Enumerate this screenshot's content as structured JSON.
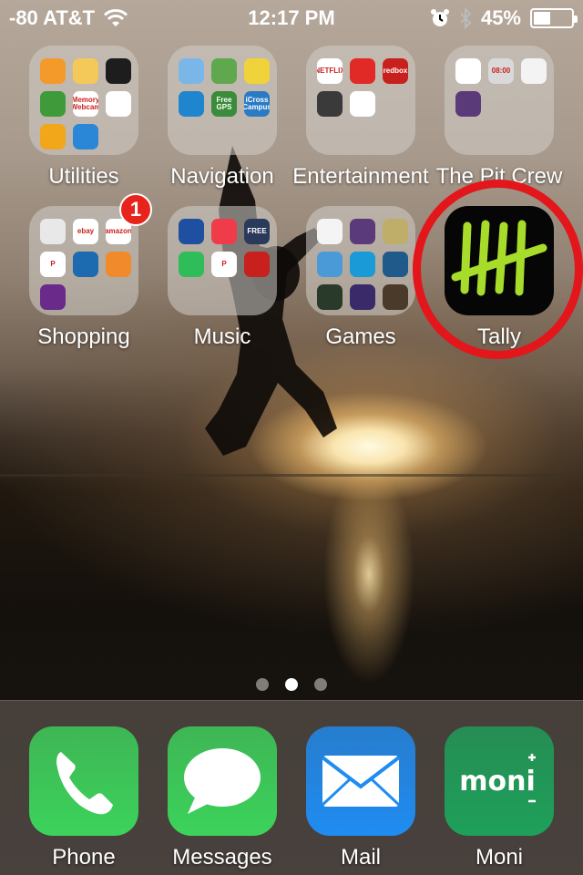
{
  "status_bar": {
    "carrier": "-80 AT&T",
    "time": "12:17 PM",
    "battery_percent": "45%",
    "battery_level": 0.45,
    "icons": [
      "wifi-icon",
      "alarm-icon",
      "bluetooth-icon",
      "battery-icon"
    ]
  },
  "home": {
    "apps": [
      {
        "label": "Utilities",
        "type": "folder",
        "mini_apps": [
          {
            "name": "calculator",
            "text": "",
            "color": "#f39a2a"
          },
          {
            "name": "podcasts",
            "text": "",
            "color": "#f5c85a"
          },
          {
            "name": "voice-memos",
            "text": "",
            "color": "#1d1d1d"
          },
          {
            "name": "find-my-iphone",
            "text": "",
            "color": "#3f9a3a"
          },
          {
            "name": "memory-webcam",
            "text": "Memory Webcam",
            "color": "#ffffff"
          },
          {
            "name": "google-drive",
            "text": "",
            "color": "#ffffff"
          },
          {
            "name": "quickoffice",
            "text": "",
            "color": "#f2a61a"
          },
          {
            "name": "ipass",
            "text": "",
            "color": "#2a86d6"
          }
        ]
      },
      {
        "label": "Navigation",
        "type": "folder",
        "mini_apps": [
          {
            "name": "maps",
            "text": "",
            "color": "#7ab7e8"
          },
          {
            "name": "google-maps",
            "text": "",
            "color": "#5fa84d"
          },
          {
            "name": "waze",
            "text": "",
            "color": "#f0d23a"
          },
          {
            "name": "runkeeper",
            "text": "",
            "color": "#1f85cf"
          },
          {
            "name": "free-gps",
            "text": "Free GPS",
            "color": "#3a8c3a"
          },
          {
            "name": "icross-campus",
            "text": "iCross Campus",
            "color": "#2a7ac4"
          }
        ]
      },
      {
        "label": "Entertainment",
        "type": "folder",
        "mini_apps": [
          {
            "name": "netflix",
            "text": "NETFLIX",
            "color": "#ffffff"
          },
          {
            "name": "youtube",
            "text": "",
            "color": "#e12a25"
          },
          {
            "name": "redbox",
            "text": "redbox",
            "color": "#c8201c"
          },
          {
            "name": "tv-remote",
            "text": "",
            "color": "#3a3a3a"
          },
          {
            "name": "chromecast",
            "text": "",
            "color": "#ffffff"
          }
        ]
      },
      {
        "label": "The Pit Crew",
        "type": "folder",
        "mini_apps": [
          {
            "name": "att",
            "text": "",
            "color": "#ffffff"
          },
          {
            "name": "wifi-clock",
            "text": "08:00",
            "color": "#d9d9d9"
          },
          {
            "name": "notepad",
            "text": "",
            "color": "#f3f3f3"
          },
          {
            "name": "cube",
            "text": "",
            "color": "#5b3a7a"
          }
        ]
      },
      {
        "label": "Shopping",
        "type": "folder",
        "badge": "1",
        "mini_apps": [
          {
            "name": "starbucks-pattern",
            "text": "",
            "color": "#e8e8e8"
          },
          {
            "name": "ebay",
            "text": "ebay",
            "color": "#ffffff"
          },
          {
            "name": "amazon",
            "text": "amazon",
            "color": "#ffffff"
          },
          {
            "name": "paypal",
            "text": "P",
            "color": "#ffffff"
          },
          {
            "name": "dominos",
            "text": "",
            "color": "#1c6ab0"
          },
          {
            "name": "shop-app",
            "text": "",
            "color": "#f08a2a"
          },
          {
            "name": "wish-heart",
            "text": "",
            "color": "#6a2a8a"
          }
        ]
      },
      {
        "label": "Music",
        "type": "folder",
        "mini_apps": [
          {
            "name": "shazam-blue",
            "text": "",
            "color": "#1f4fa0"
          },
          {
            "name": "itunes-music",
            "text": "",
            "color": "#ef3b4a"
          },
          {
            "name": "globe-free",
            "text": "FREE",
            "color": "#2a3a5a"
          },
          {
            "name": "spotify",
            "text": "",
            "color": "#2ebd59"
          },
          {
            "name": "pandora",
            "text": "P",
            "color": "#ffffff"
          },
          {
            "name": "iheartradio",
            "text": "",
            "color": "#c8201c"
          }
        ]
      },
      {
        "label": "Games",
        "type": "folder",
        "mini_apps": [
          {
            "name": "game-center",
            "text": "",
            "color": "#f4f4f4"
          },
          {
            "name": "game-2",
            "text": "",
            "color": "#5a3a7a"
          },
          {
            "name": "tic-tac-toe",
            "text": "",
            "color": "#bfae6a"
          },
          {
            "name": "candy-crush",
            "text": "",
            "color": "#4a9ad8"
          },
          {
            "name": "target-game",
            "text": "",
            "color": "#1a9ad6"
          },
          {
            "name": "cut-the-rope",
            "text": "",
            "color": "#1f5a8a"
          },
          {
            "name": "fruit-ninja",
            "text": "",
            "color": "#2a3a2a"
          },
          {
            "name": "subway-surfers",
            "text": "",
            "color": "#3a2a6a"
          },
          {
            "name": "doors",
            "text": "",
            "color": "#4a3a2a"
          }
        ]
      },
      {
        "label": "Tally",
        "type": "app",
        "icon": "tally-marks-icon",
        "colors": {
          "bg": "#060606",
          "marks": "#a8dc2a"
        }
      }
    ],
    "page_dots": {
      "count": 3,
      "active": 1
    }
  },
  "dock": {
    "apps": [
      {
        "label": "Phone",
        "icon": "phone-icon",
        "color": "#3cd35b"
      },
      {
        "label": "Messages",
        "icon": "speech-bubble-icon",
        "color": "#3cd35b"
      },
      {
        "label": "Mail",
        "icon": "envelope-icon",
        "color": "#1f8cf2"
      },
      {
        "label": "Moni",
        "icon": "moni-logo-icon",
        "color": "#1ea05a",
        "logo_text": "moni"
      }
    ]
  },
  "colors": {
    "highlight_circle": "#e3161c",
    "badge": "#e8231c"
  }
}
